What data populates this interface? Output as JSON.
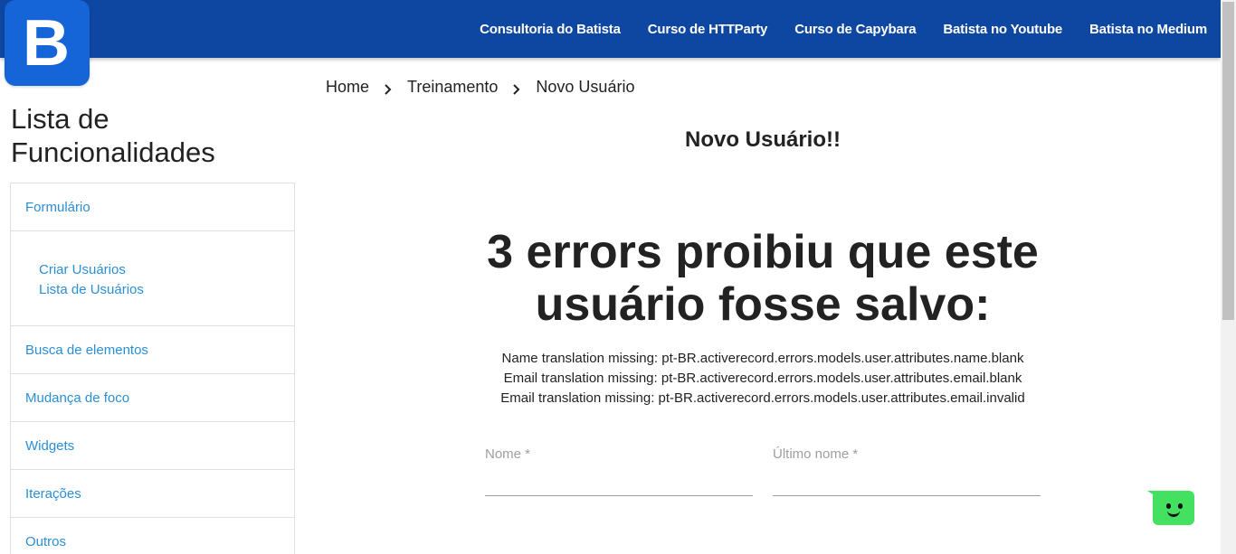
{
  "logo": {
    "letter": "B"
  },
  "nav": {
    "items": [
      "Consultoria do Batista",
      "Curso de HTTParty",
      "Curso de Capybara",
      "Batista no Youtube",
      "Batista no Medium"
    ]
  },
  "sidebar": {
    "title_line1": "Lista de",
    "title_line2": "Funcionalidades",
    "items": [
      {
        "label": "Formulário"
      },
      {
        "label": "Busca de elementos"
      },
      {
        "label": "Mudança de foco"
      },
      {
        "label": "Widgets"
      },
      {
        "label": "Iterações"
      },
      {
        "label": "Outros"
      }
    ],
    "subitems": [
      {
        "label": "Criar Usuários"
      },
      {
        "label": "Lista de Usuários"
      }
    ]
  },
  "breadcrumb": {
    "items": [
      "Home",
      "Treinamento",
      "Novo Usuário"
    ],
    "separator": "›"
  },
  "form": {
    "title": "Novo Usuário!!",
    "error_title_line1": "3 errors proibiu que este",
    "error_title_line2": "usuário fosse salvo:",
    "errors": [
      "Name translation missing: pt-BR.activerecord.errors.models.user.attributes.name.blank",
      "Email translation missing: pt-BR.activerecord.errors.models.user.attributes.email.blank",
      "Email translation missing: pt-BR.activerecord.errors.models.user.attributes.email.invalid"
    ],
    "fields": {
      "first_name_label": "Nome *",
      "last_name_label": "Último nome *",
      "first_name_value": "",
      "last_name_value": ""
    }
  },
  "colors": {
    "nav_bg": "#0d47a1",
    "logo_bg": "#1565d8",
    "link": "#2b8fd6",
    "chat_bot": "#44e060"
  },
  "icons": {
    "breadcrumb_separator": "chevron-right-icon",
    "chat_widget": "chat-bot-icon"
  }
}
